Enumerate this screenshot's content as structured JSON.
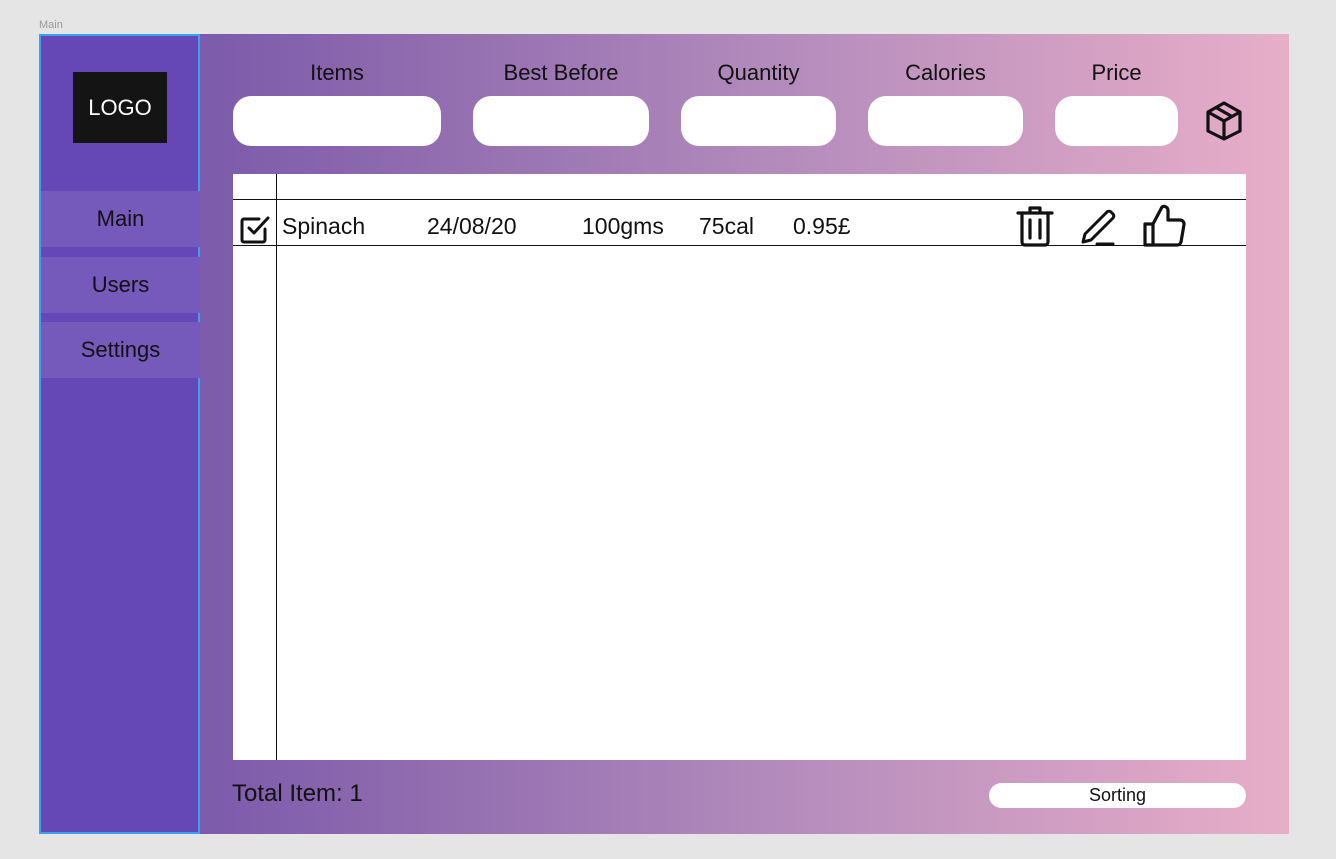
{
  "frame": {
    "label": "Main"
  },
  "sidebar": {
    "logo": "LOGO",
    "items": [
      {
        "label": "Main"
      },
      {
        "label": "Users"
      },
      {
        "label": "Settings"
      }
    ]
  },
  "form": {
    "fields": [
      {
        "label": "Items",
        "value": "",
        "placeholder": ""
      },
      {
        "label": "Best Before",
        "value": "",
        "placeholder": ""
      },
      {
        "label": "Quantity",
        "value": "",
        "placeholder": ""
      },
      {
        "label": "Calories",
        "value": "",
        "placeholder": ""
      },
      {
        "label": "Price",
        "value": "",
        "placeholder": ""
      }
    ],
    "add_icon": "cube-icon"
  },
  "table": {
    "rows": [
      {
        "checked": true,
        "item": "Spinach",
        "best_before": "24/08/20",
        "quantity": "100gms",
        "calories": "75cal",
        "price": "0.95£",
        "actions": [
          "trash-icon",
          "pencil-icon",
          "thumbs-up-icon"
        ]
      }
    ]
  },
  "footer": {
    "total": "Total Item: 1",
    "sorting_label": "Sorting"
  },
  "colors": {
    "sidebar": "#6548b6",
    "sidebar_item": "#7559bb",
    "gradient_start": "#6c4fab",
    "gradient_end": "#e8aec8",
    "selection_border": "#3aa0f0"
  }
}
